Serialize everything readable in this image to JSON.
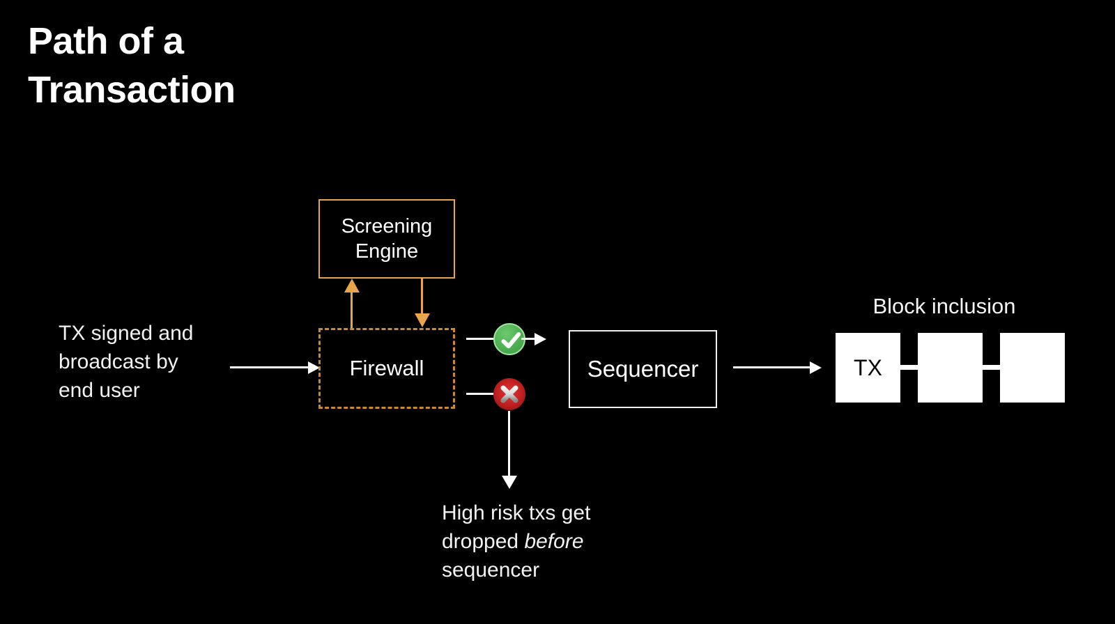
{
  "title": "Path of a\nTransaction",
  "background_color": "#000000",
  "colors": {
    "accent_orange": "#e8a54b",
    "firewall_dash": "#c98a30",
    "check_green": "#4caf50",
    "x_red": "#c22020",
    "text_white": "#ffffff",
    "block_white": "#ffffff"
  },
  "nodes": {
    "intake_text": "TX signed and\nbroadcast by\nend user",
    "screening_engine": "Screening\nEngine",
    "firewall": "Firewall",
    "sequencer": "Sequencer",
    "block_inclusion_label": "Block inclusion",
    "tx_block_label": "TX",
    "drop_text_part1": "High risk txs get\ndropped ",
    "drop_text_emphasis": "before",
    "drop_text_part2": "\nsequencer"
  },
  "icons": {
    "check": "check-circle-icon",
    "cross": "x-circle-icon",
    "arrow_right": "arrow-right-icon",
    "arrow_down": "arrow-down-icon",
    "arrow_up": "arrow-up-icon"
  },
  "chain": {
    "blocks": [
      "TX",
      "",
      ""
    ]
  }
}
